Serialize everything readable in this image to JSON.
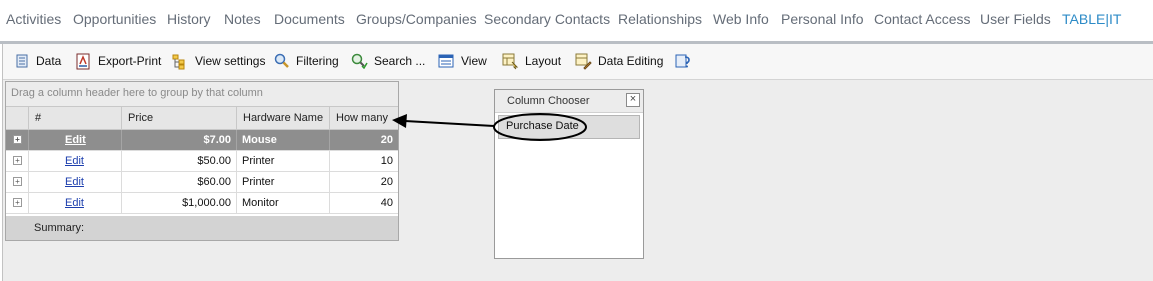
{
  "tabs": [
    {
      "label": "Activities"
    },
    {
      "label": "Opportunities"
    },
    {
      "label": "History"
    },
    {
      "label": "Notes"
    },
    {
      "label": "Documents"
    },
    {
      "label": "Groups/Companies"
    },
    {
      "label": "Secondary Contacts"
    },
    {
      "label": "Relationships"
    },
    {
      "label": "Web Info"
    },
    {
      "label": "Personal Info"
    },
    {
      "label": "Contact Access"
    },
    {
      "label": "User Fields"
    },
    {
      "label": "TABLE|IT"
    }
  ],
  "toolbar": {
    "data": "Data",
    "export_print": "Export-Print",
    "view_settings": "View settings",
    "filtering": "Filtering",
    "search": "Search ...",
    "view": "View",
    "layout": "Layout",
    "data_editing": "Data Editing"
  },
  "grid": {
    "group_hint": "Drag a column header here to group by that column",
    "columns": [
      "#",
      "Price",
      "Hardware Name",
      "How many"
    ],
    "rows": [
      {
        "edit": "Edit",
        "price": "$7.00",
        "name": "Mouse",
        "qty": "20"
      },
      {
        "edit": "Edit",
        "price": "$50.00",
        "name": "Printer",
        "qty": "10"
      },
      {
        "edit": "Edit",
        "price": "$60.00",
        "name": "Printer",
        "qty": "20"
      },
      {
        "edit": "Edit",
        "price": "$1,000.00",
        "name": "Monitor",
        "qty": "40"
      }
    ],
    "summary_label": "Summary:",
    "expand_glyph": "+"
  },
  "chooser": {
    "title": "Column Chooser",
    "close": "×",
    "items": [
      "Purchase Date"
    ]
  },
  "colors": {
    "accent_tab": "#2d8bc7",
    "selected_row": "#8e8e8e",
    "link": "#1d3fae"
  }
}
